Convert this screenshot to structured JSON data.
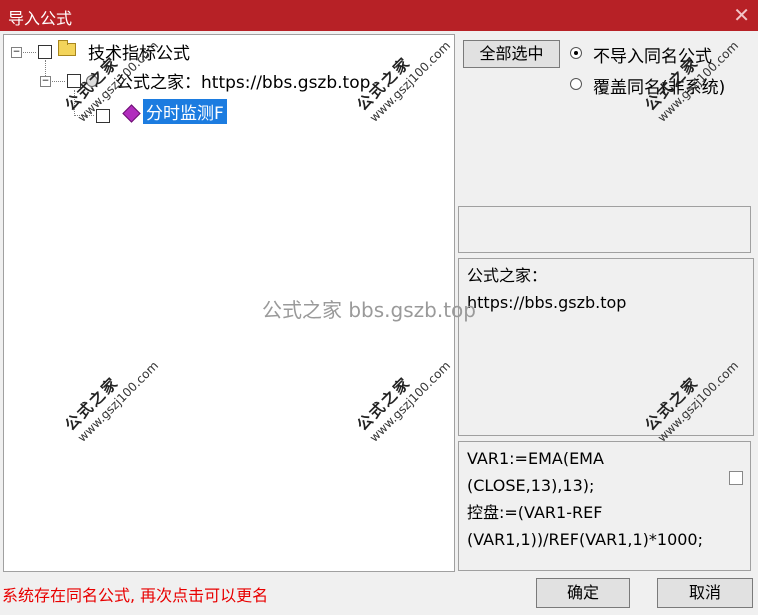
{
  "window": {
    "title": "导入公式",
    "close_glyph": "✕"
  },
  "tree": {
    "root_label": "技术指标公式",
    "child_label": "公式之家：https://bbs.gszb.top",
    "leaf_label": "分时监测F"
  },
  "options": {
    "select_all_label": "全部选中",
    "radio_no_import_label": "不导入同名公式",
    "radio_overwrite_label": "覆盖同名(非系统)",
    "selected": "radio_no_import"
  },
  "description": {
    "line1": "公式之家：",
    "line2": "https://bbs.gszb.top"
  },
  "code": {
    "lines": [
      "VAR1:=EMA(EMA",
      "(CLOSE,13),13);",
      "控盘:=(VAR1-REF",
      "(VAR1,1))/REF(VAR1,1)*1000;"
    ]
  },
  "status_text": "系统存在同名公式, 再次点击可以更名",
  "buttons": {
    "ok_label": "确定",
    "cancel_label": "取消"
  },
  "watermark": {
    "title": "公式之家",
    "url": "www.gszj100.com",
    "center_text": "公式之家 bbs.gszb.top"
  },
  "colors": {
    "titlebar": "#b72126",
    "selection": "#1c7ce0",
    "status": "#e80000"
  }
}
